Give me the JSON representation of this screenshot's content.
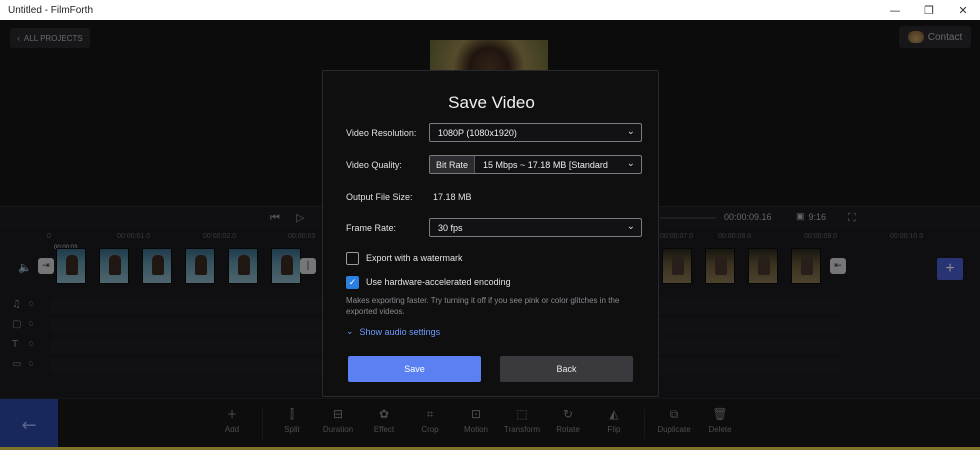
{
  "window": {
    "title": "Untitled - FilmForth",
    "minimize": "—",
    "restore": "❐",
    "close": "✕"
  },
  "header": {
    "all_projects": "ALL PROJECTS",
    "contact": "Contact"
  },
  "playback": {
    "time": "00:00:09.16",
    "ratio": "9:16"
  },
  "timeline": {
    "ticks": [
      "0",
      "00:00:01.0",
      "00:00:02.0",
      "00:00:03",
      "00:00:07.0",
      "00:00:08.0",
      "00:00:09.0",
      "00:00:10.0"
    ],
    "clip_time": "00:00:03",
    "track_counts": [
      "0",
      "0",
      "0",
      "0"
    ]
  },
  "modal": {
    "title": "Save Video",
    "resolution_label": "Video Resolution:",
    "resolution_value": "1080P (1080x1920)",
    "quality_label": "Video Quality:",
    "quality_mode": "Bit Rate",
    "quality_value": "15 Mbps ~ 17.18 MB [Standard",
    "filesize_label": "Output File Size:",
    "filesize_value": "17.18 MB",
    "framerate_label": "Frame Rate:",
    "framerate_value": "30 fps",
    "watermark_label": "Export with a watermark",
    "watermark_checked": false,
    "hw_label": "Use hardware-accelerated encoding",
    "hw_checked": true,
    "hint": "Makes exporting faster. Try turning it off if you see pink or color glitches in the exported videos.",
    "audio_link": "Show audio settings",
    "save": "Save",
    "back": "Back"
  },
  "toolbar": {
    "add": "Add",
    "split": "Split",
    "duration": "Duration",
    "effect": "Effect",
    "crop": "Crop",
    "motion": "Motion",
    "transform": "Transform",
    "rotate": "Rotate",
    "flip": "Flip",
    "duplicate": "Duplicate",
    "delete": "Delete"
  },
  "colors": {
    "accent": "#5b80f2",
    "check": "#2b7fe0",
    "back_nav": "#2e4aa8"
  }
}
